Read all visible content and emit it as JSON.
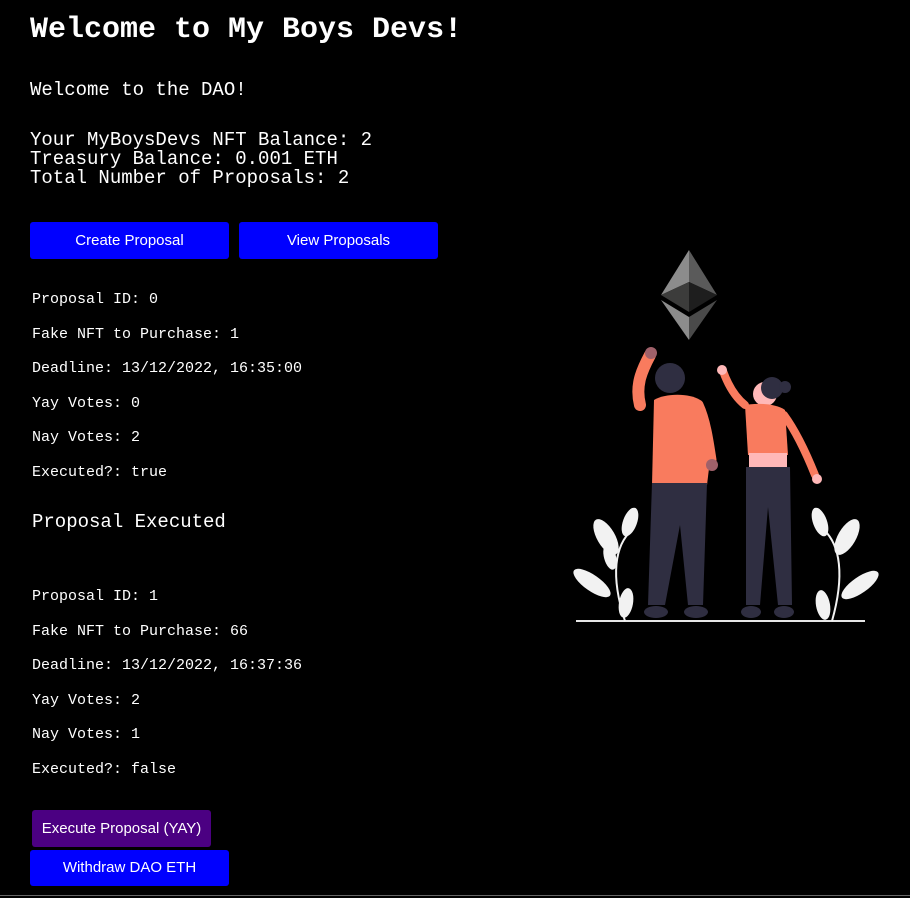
{
  "header": {
    "title": "Welcome to My Boys Devs!",
    "subtitle": "Welcome to the DAO!"
  },
  "stats": {
    "nft_balance": "Your MyBoysDevs NFT Balance: 2",
    "treasury_balance": "Treasury Balance: 0.001 ETH",
    "total_proposals": "Total Number of Proposals: 2"
  },
  "tabs": {
    "create_label": "Create Proposal",
    "view_label": "View Proposals"
  },
  "proposals": [
    {
      "id": "Proposal ID: 0",
      "nft": "Fake NFT to Purchase: 1",
      "deadline": "Deadline: 13/12/2022, 16:35:00",
      "yay": "Yay Votes: 0",
      "nay": "Nay Votes: 2",
      "executed": "Executed?: true",
      "status": "Proposal Executed"
    },
    {
      "id": "Proposal ID: 1",
      "nft": "Fake NFT to Purchase: 66",
      "deadline": "Deadline: 13/12/2022, 16:37:36",
      "yay": "Yay Votes: 2",
      "nay": "Nay Votes: 1",
      "executed": "Executed?: false",
      "execute_label": "Execute Proposal (YAY)"
    }
  ],
  "withdraw_label": "Withdraw DAO ETH",
  "colors": {
    "background": "#000000",
    "button_blue": "#0000ff",
    "button_purple": "#4b0082",
    "illustration_orange": "#f97b5e",
    "illustration_dark": "#2f2e41"
  },
  "icons": {
    "hero": "ethereum-people-illustration"
  }
}
